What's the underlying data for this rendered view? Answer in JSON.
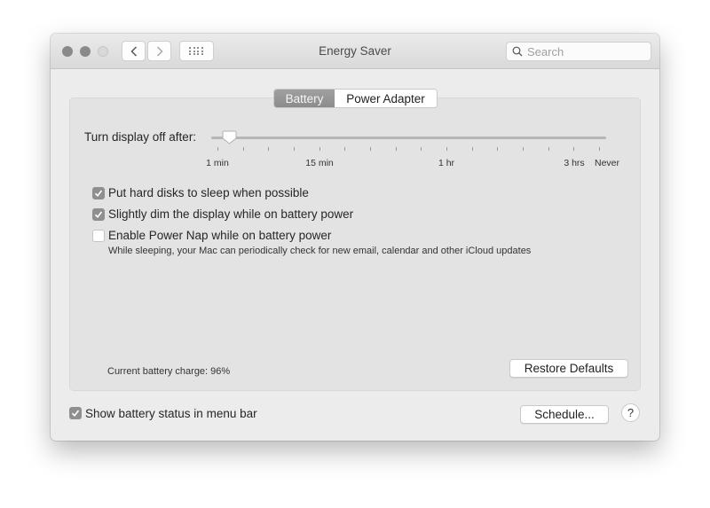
{
  "window": {
    "title": "Energy Saver",
    "traffic_lights": [
      "close",
      "minimize",
      "zoom"
    ],
    "nav": {
      "back_icon": "chevron-left-icon",
      "forward_icon": "chevron-right-icon",
      "grid_icon": "show-all-grid-icon"
    },
    "search": {
      "placeholder": "Search",
      "value": ""
    }
  },
  "tabs": [
    {
      "label": "Battery",
      "active": true
    },
    {
      "label": "Power Adapter",
      "active": false
    }
  ],
  "display_sleep": {
    "label": "Turn display off after:",
    "value": "1 min",
    "tick_count": 16,
    "tick_labels": [
      "1 min",
      "15 min",
      "1 hr",
      "3 hrs",
      "Never"
    ]
  },
  "options": [
    {
      "label": "Put hard disks to sleep when possible",
      "checked": true
    },
    {
      "label": "Slightly dim the display while on battery power",
      "checked": true
    },
    {
      "label": "Enable Power Nap while on battery power",
      "checked": false,
      "description": "While sleeping, your Mac can periodically check for new email, calendar and other iCloud updates"
    }
  ],
  "battery_charge": "Current battery charge: 96%",
  "buttons": {
    "restore_defaults": "Restore Defaults",
    "schedule": "Schedule...",
    "help": "?"
  },
  "show_battery_status": {
    "label": "Show battery status in menu bar",
    "checked": true
  }
}
